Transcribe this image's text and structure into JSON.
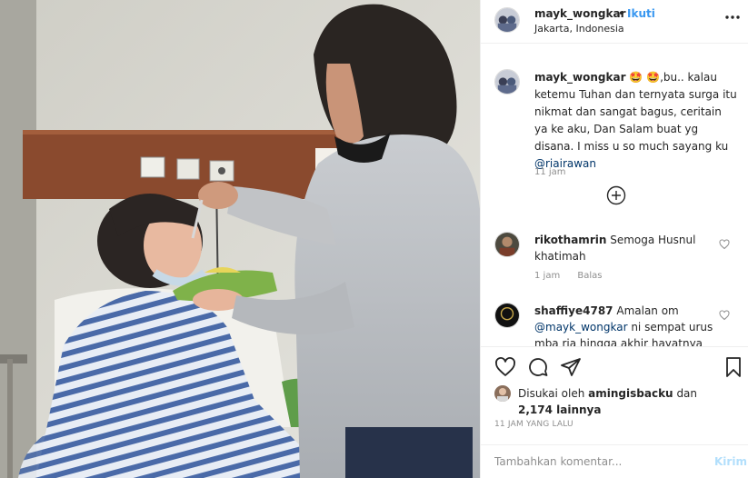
{
  "post": {
    "author": "mayk_wongkar",
    "separator": "•",
    "follow_label": "Ikuti",
    "location": "Jakarta, Indonesia"
  },
  "caption": {
    "username": "mayk_wongkar",
    "emoji1": "🤩",
    "emoji2": "🤩",
    "text": ",bu.. kalau ketemu Tuhan dan ternyata surga itu nikmat dan sangat bagus, ceritain ya ke aku, Dan Salam buat yg disana. I miss u so much sayang ku",
    "mention": "@riairawan",
    "time": "11 jam"
  },
  "comments": [
    {
      "username": "rikothamrin",
      "text": "Semoga Husnul khatimah",
      "time": "1 jam",
      "reply_label": "Balas"
    },
    {
      "username": "shaffiye4787",
      "text_before": "Amalan om",
      "mention": "@mayk_wongkar",
      "text_after": "ni sempat urus mba ria hingga akhir hayatnya"
    }
  ],
  "likes": {
    "prefix": "Disukai oleh",
    "user": "amingisbacku",
    "middle": "dan",
    "count": "2,174 lainnya"
  },
  "posted_ago": "11 JAM YANG LALU",
  "composer": {
    "placeholder": "Tambahkan komentar...",
    "send_label": "Kirim"
  },
  "icons": {
    "more": "more-dots-icon",
    "add": "plus-circle-icon",
    "like": "heart-icon",
    "comment": "comment-bubble-icon",
    "share": "paper-plane-icon",
    "save": "bookmark-icon"
  },
  "colors": {
    "link": "#3897f0",
    "muted": "#8e8e8e",
    "border": "#efefef",
    "send_disabled": "#b2dffc"
  }
}
